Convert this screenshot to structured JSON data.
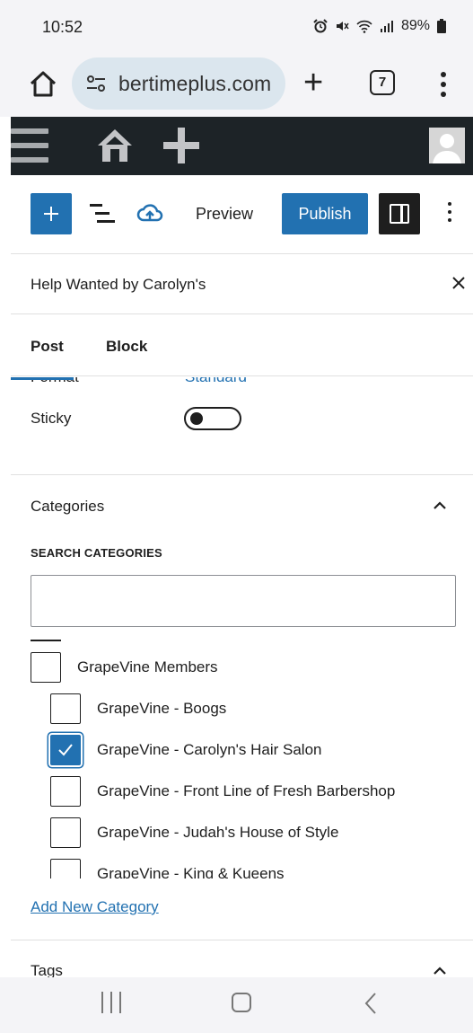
{
  "status_bar": {
    "time": "10:52",
    "battery": "89%"
  },
  "browser": {
    "url": "bertimeplus.com",
    "tab_count": "7"
  },
  "editor_toolbar": {
    "preview_label": "Preview",
    "publish_label": "Publish"
  },
  "sidebar": {
    "post_title": "Help Wanted by Carolyn's",
    "tabs": [
      "Post",
      "Block"
    ],
    "format_label": "Format",
    "format_value": "Standard",
    "sticky_label": "Sticky",
    "sticky_on": false
  },
  "categories": {
    "heading": "Categories",
    "search_label": "SEARCH CATEGORIES",
    "search_value": "",
    "items": [
      {
        "label": "GrapeVine Members",
        "checked": false,
        "level": 0
      },
      {
        "label": "GrapeVine - Boogs",
        "checked": false,
        "level": 1
      },
      {
        "label": "GrapeVine - Carolyn's Hair Salon",
        "checked": true,
        "level": 1
      },
      {
        "label": "GrapeVine - Front Line of Fresh Barbershop",
        "checked": false,
        "level": 1
      },
      {
        "label": "GrapeVine - Judah's House of Style",
        "checked": false,
        "level": 1
      },
      {
        "label": "GrapeVine - King & Kueens",
        "checked": false,
        "level": 1
      }
    ],
    "add_new_label": "Add New Category"
  },
  "tags": {
    "heading": "Tags"
  },
  "colors": {
    "wp_blue": "#2271b1",
    "admin_bar": "#1d2327",
    "system_bar": "#f4f4f7"
  }
}
